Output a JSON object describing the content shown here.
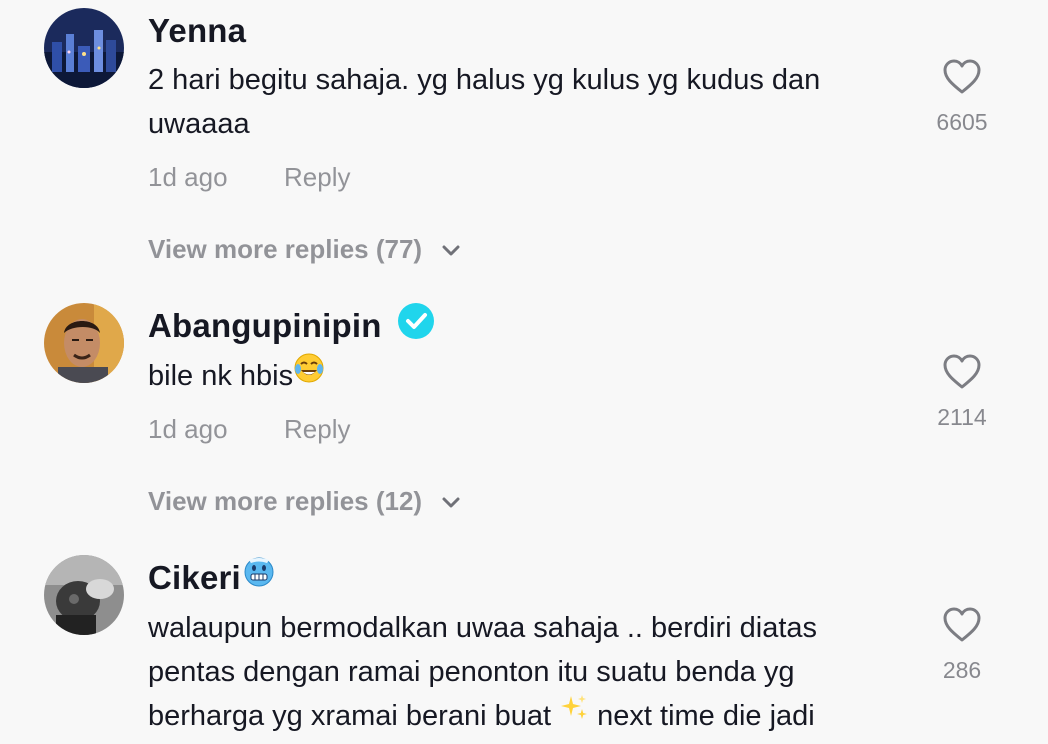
{
  "comments": [
    {
      "username": "Yenna",
      "text_lines": [
        "2 hari begitu sahaja. yg halus yg kulus yg kudus dan",
        "uwaaaa"
      ],
      "time": "1d ago",
      "reply_label": "Reply",
      "likes": "6605",
      "more_replies": "View more replies (77)"
    },
    {
      "username": "Abangupinipin",
      "verified": true,
      "text": "bile nk hbis",
      "text_emoji": "tears-of-joy-emoji",
      "time": "1d ago",
      "reply_label": "Reply",
      "likes": "2114",
      "more_replies": "View more replies (12)"
    },
    {
      "username": "Cikeri",
      "username_emoji": "cold-face-emoji",
      "text_lines": [
        "walaupun bermodalkan uwaa sahaja .. berdiri diatas",
        "pentas dengan ramai penonton itu suatu benda yg",
        "berharga yg xramai berani buat",
        "next time die jadi"
      ],
      "text_emoji": "sparkles-emoji",
      "likes": "286"
    }
  ],
  "colors": {
    "background": "#f8f8f8",
    "primary_text": "#161823",
    "verified_badge": "#20d5ec"
  }
}
